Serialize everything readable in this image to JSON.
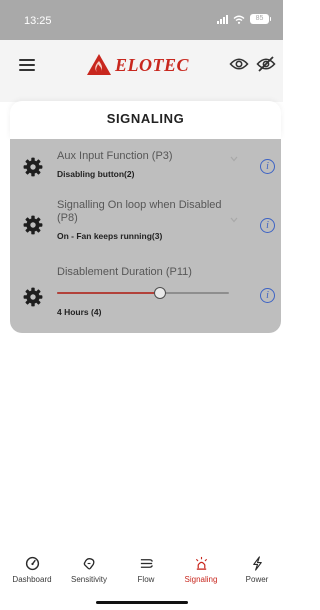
{
  "status_bar": {
    "time": "13:25",
    "battery": "85"
  },
  "header": {
    "logo_text": "ELOTEC",
    "icons": [
      "menu-icon",
      "eye-icon",
      "eye-off-icon"
    ]
  },
  "page": {
    "title": "SIGNALING"
  },
  "settings": [
    {
      "label": "Aux Input Function (P3)",
      "value": "Disabling button(2)",
      "control": "dropdown",
      "icon": "gear-icon"
    },
    {
      "label": "Signalling On loop when Disabled (P8)",
      "value": "On - Fan keeps running(3)",
      "control": "dropdown",
      "icon": "gear-icon"
    },
    {
      "label": "Disablement Duration (P11)",
      "value": "4 Hours (4)",
      "control": "slider",
      "slider_fraction": 0.6,
      "icon": "gear-icon"
    }
  ],
  "bottom_nav": [
    {
      "label": "Dashboard",
      "icon": "gauge-icon",
      "active": false
    },
    {
      "label": "Sensitivity",
      "icon": "sensitivity-icon",
      "active": false
    },
    {
      "label": "Flow",
      "icon": "flow-icon",
      "active": false
    },
    {
      "label": "Signaling",
      "icon": "alarm-light-icon",
      "active": true
    },
    {
      "label": "Power",
      "icon": "power-bolt-icon",
      "active": false
    }
  ],
  "colors": {
    "accent": "#c8271e",
    "info_blue": "#3d63c4",
    "panel_gray": "#bebebe",
    "status_bar_gray": "#a9a9a9",
    "slider_fill": "#b2413a"
  }
}
